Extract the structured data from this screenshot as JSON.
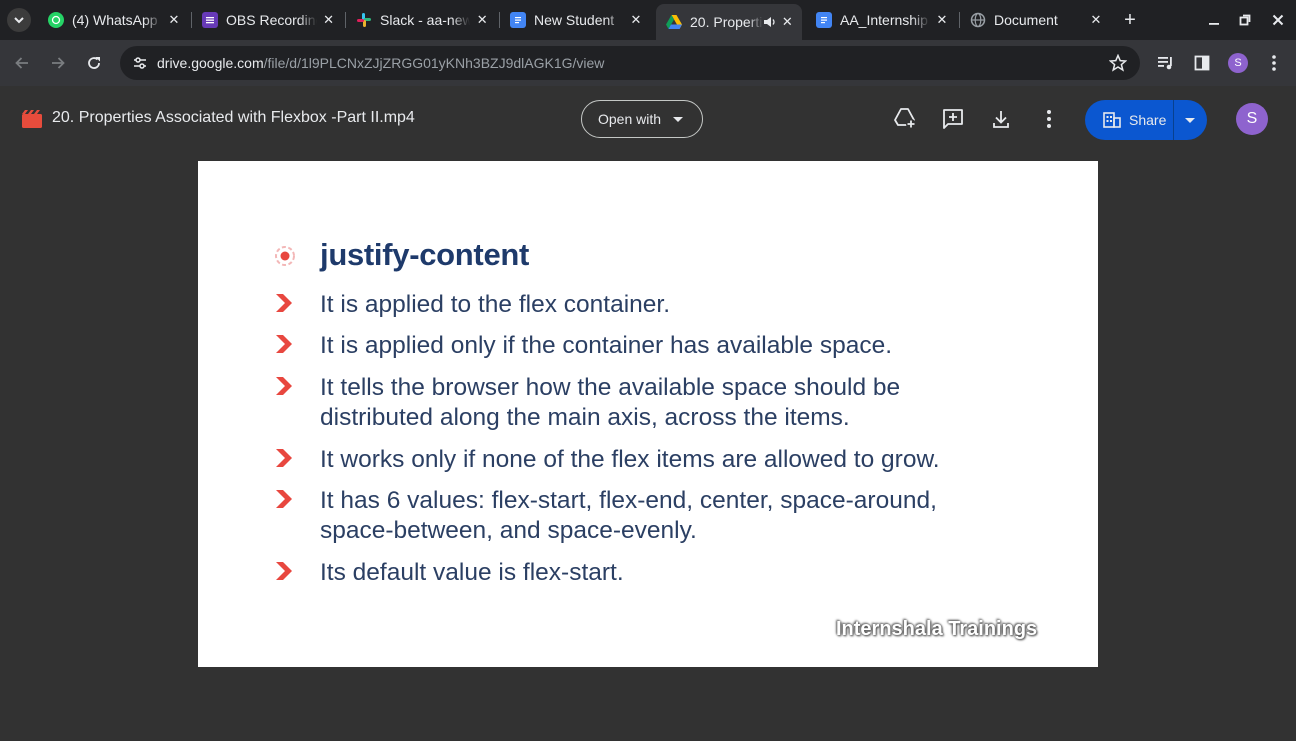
{
  "browser": {
    "tabs": [
      {
        "title": "(4) WhatsApp",
        "icon": "whatsapp-icon",
        "active": false
      },
      {
        "title": "OBS Recording",
        "icon": "forms-icon",
        "active": false
      },
      {
        "title": "Slack - aa-new",
        "icon": "slack-icon",
        "active": false
      },
      {
        "title": "New Student",
        "icon": "docs-icon",
        "active": false
      },
      {
        "title": "20. Properties",
        "icon": "drive-icon",
        "active": true,
        "audio": "speaker-icon"
      },
      {
        "title": "AA_Internship",
        "icon": "docs-icon",
        "active": false
      },
      {
        "title": "Document",
        "icon": "globe-icon",
        "active": false
      }
    ],
    "new_tab_label": "+",
    "url_host": "drive.google.com",
    "url_path": "/file/d/1l9PLCNxZJjZRGG01yKNh3BZJ9dlAGK1G/view",
    "profile_initial": "S"
  },
  "viewer": {
    "file_title": "20. Properties Associated with Flexbox -Part II.mp4",
    "open_with_label": "Open with",
    "share_label": "Share",
    "avatar_initial": "S",
    "accent_color": "#0b57d0"
  },
  "slide": {
    "heading": "justify-content",
    "points": [
      {
        "lines": [
          "It is applied to the flex container."
        ]
      },
      {
        "lines": [
          "It is applied only if the container has available space."
        ]
      },
      {
        "lines": [
          "It tells the browser how the available space should be",
          "distributed along the main axis, across the items."
        ]
      },
      {
        "lines": [
          "It works only if none of the flex items are allowed to grow."
        ]
      },
      {
        "lines": [
          "It has 6 values: flex-start, flex-end, center, space-around,",
          "space-between, and space-evenly."
        ]
      },
      {
        "lines": [
          "Its default value is flex-start."
        ]
      }
    ],
    "watermark": "Internshala Trainings"
  }
}
